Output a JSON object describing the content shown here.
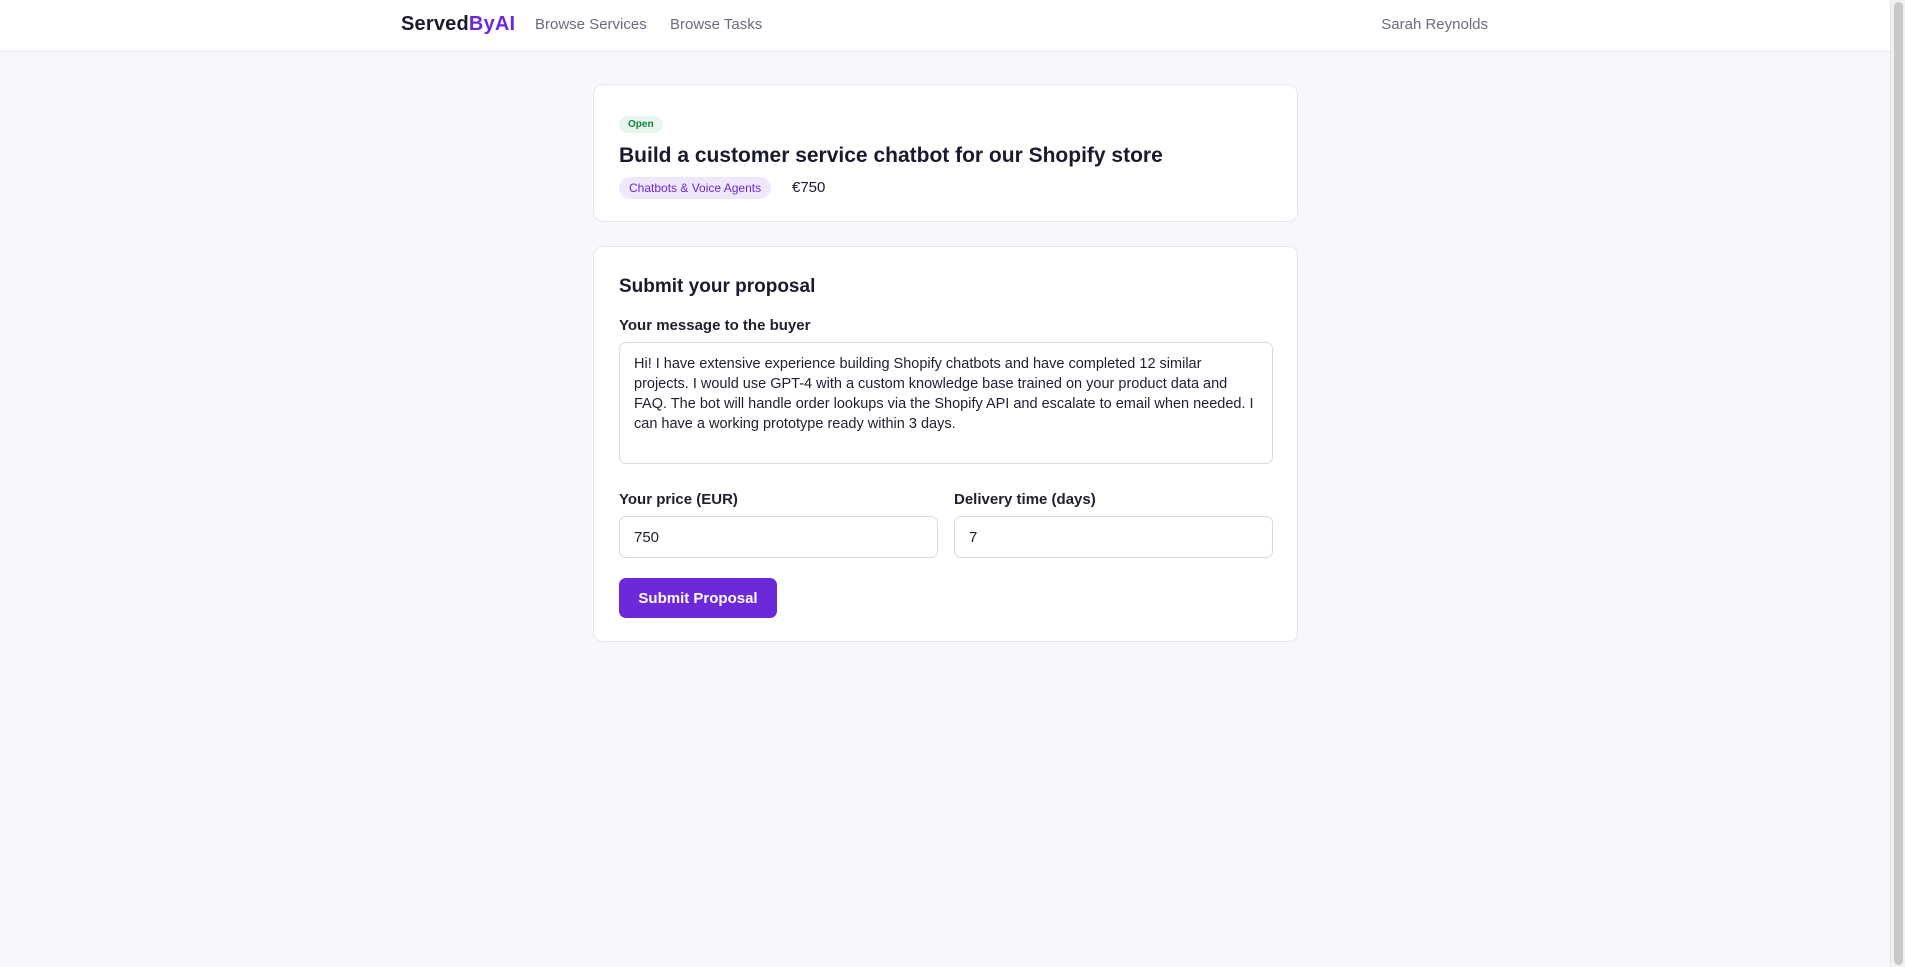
{
  "header": {
    "brand_primary": "Served",
    "brand_accent": "ByAI",
    "nav": {
      "browse_services": "Browse Services",
      "browse_tasks": "Browse Tasks"
    },
    "user_name": "Sarah Reynolds"
  },
  "task": {
    "status": "Open",
    "title": "Build a customer service chatbot for our Shopify store",
    "category": "Chatbots & Voice Agents",
    "price": "€750"
  },
  "proposal": {
    "section_title": "Submit your proposal",
    "message_label": "Your message to the buyer",
    "message_value": "Hi! I have extensive experience building Shopify chatbots and have completed 12 similar projects. I would use GPT-4 with a custom knowledge base trained on your product data and FAQ. The bot will handle order lookups via the Shopify API and escalate to email when needed. I can have a working prototype ready within 3 days.",
    "price_label": "Your price (EUR)",
    "price_value": "750",
    "delivery_label": "Delivery time (days)",
    "delivery_value": "7",
    "submit_label": "Submit Proposal"
  },
  "colors": {
    "accent": "#6d28d9",
    "status_green": "#15803d",
    "background": "#f8f8fc"
  }
}
